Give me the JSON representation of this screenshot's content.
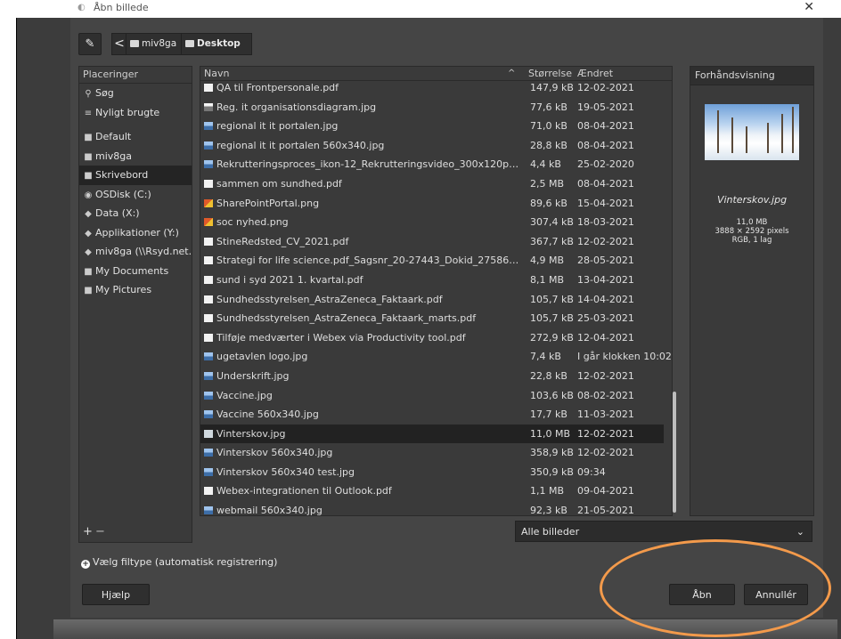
{
  "dialog": {
    "title": "Åbn billede",
    "close_label": "✕"
  },
  "toolbar": {
    "edit_location_icon": "edit-icon",
    "back_label": "<"
  },
  "breadcrumbs": [
    "miv8ga",
    "Desktop"
  ],
  "places": {
    "header": "Placeringer",
    "items": [
      {
        "label": "Søg",
        "icon": "search-icon",
        "glyph": "⚲"
      },
      {
        "label": "Nyligt brugte",
        "icon": "recent-icon",
        "glyph": "≡"
      },
      {
        "label": "Default",
        "icon": "folder-icon",
        "glyph": "■"
      },
      {
        "label": "miv8ga",
        "icon": "folder-icon",
        "glyph": "■"
      },
      {
        "label": "Skrivebord",
        "icon": "folder-icon",
        "glyph": "■",
        "active": true
      },
      {
        "label": "OSDisk (C:)",
        "icon": "drive-icon",
        "glyph": "◉"
      },
      {
        "label": "Data (X:)",
        "icon": "network-drive-icon",
        "glyph": "◆"
      },
      {
        "label": "Applikationer (Y:)",
        "icon": "network-drive-icon",
        "glyph": "◆"
      },
      {
        "label": "miv8ga (\\\\Rsyd.net...",
        "icon": "network-drive-icon",
        "glyph": "◆"
      },
      {
        "label": "My Documents",
        "icon": "folder-icon",
        "glyph": "■"
      },
      {
        "label": "My Pictures",
        "icon": "folder-icon",
        "glyph": "■"
      }
    ],
    "add_label": "+",
    "remove_label": "−"
  },
  "files": {
    "columns": {
      "name": "Navn",
      "size": "Størrelse",
      "modified": "Ændret",
      "sort_indicator": "^"
    },
    "rows": [
      {
        "name": "QA til Frontpersonale.pdf",
        "size": "147,9 kB",
        "date": "12-02-2021",
        "type": "pdf"
      },
      {
        "name": "Reg. it organisationsdiagram.jpg",
        "size": "77,6 kB",
        "date": "19-05-2021",
        "type": "dia"
      },
      {
        "name": "regional it it portalen.jpg",
        "size": "71,0 kB",
        "date": "08-04-2021",
        "type": "img"
      },
      {
        "name": "regional it it portalen 560x340.jpg",
        "size": "28,8 kB",
        "date": "08-04-2021",
        "type": "img"
      },
      {
        "name": "Rekrutteringsproces_ikon-12_Rekrutteringsvideo_300x120px_web...",
        "size": "4,4 kB",
        "date": "25-02-2020",
        "type": "img"
      },
      {
        "name": "sammen om sundhed.pdf",
        "size": "2,5 MB",
        "date": "08-04-2021",
        "type": "pdf"
      },
      {
        "name": "SharePointPortal.png",
        "size": "89,6 kB",
        "date": "15-04-2021",
        "type": "png"
      },
      {
        "name": "soc nyhed.png",
        "size": "307,4 kB",
        "date": "18-03-2021",
        "type": "png"
      },
      {
        "name": "StineRedsted_CV_2021.pdf",
        "size": "367,7 kB",
        "date": "12-02-2021",
        "type": "pdf"
      },
      {
        "name": "Strategi for life science.pdf_Sagsnr_20-27443_Dokid_275863-21_...",
        "size": "4,9 MB",
        "date": "28-05-2021",
        "type": "pdf"
      },
      {
        "name": "sund i syd 2021 1. kvartal.pdf",
        "size": "8,1 MB",
        "date": "13-04-2021",
        "type": "pdf"
      },
      {
        "name": "Sundhedsstyrelsen_AstraZeneca_Faktaark.pdf",
        "size": "105,7 kB",
        "date": "14-04-2021",
        "type": "pdf"
      },
      {
        "name": "Sundhedsstyrelsen_AstraZeneca_Faktaark_marts.pdf",
        "size": "105,7 kB",
        "date": "25-03-2021",
        "type": "pdf"
      },
      {
        "name": "Tilføje medværter i Webex via Productivity tool.pdf",
        "size": "272,9 kB",
        "date": "12-04-2021",
        "type": "pdf"
      },
      {
        "name": "ugetavlen logo.jpg",
        "size": "7,4 kB",
        "date": "I går klokken 10:02",
        "type": "img"
      },
      {
        "name": "Underskrift.jpg",
        "size": "22,8 kB",
        "date": "12-02-2021",
        "type": "img"
      },
      {
        "name": "Vaccine.jpg",
        "size": "103,6 kB",
        "date": "08-02-2021",
        "type": "img"
      },
      {
        "name": "Vaccine 560x340.jpg",
        "size": "17,7 kB",
        "date": "11-03-2021",
        "type": "img"
      },
      {
        "name": "Vinterskov.jpg",
        "size": "11,0 MB",
        "date": "12-02-2021",
        "type": "photo",
        "selected": true
      },
      {
        "name": "Vinterskov 560x340.jpg",
        "size": "358,9 kB",
        "date": "12-02-2021",
        "type": "img"
      },
      {
        "name": "Vinterskov 560x340 test.jpg",
        "size": "350,9 kB",
        "date": "09:34",
        "type": "img"
      },
      {
        "name": "Webex-integrationen til Outlook.pdf",
        "size": "1,1 MB",
        "date": "09-04-2021",
        "type": "pdf"
      },
      {
        "name": "webmail 560x340.jpg",
        "size": "92,3 kB",
        "date": "21-05-2021",
        "type": "img"
      }
    ]
  },
  "preview": {
    "header": "Forhåndsvisning",
    "name": "Vinterskov.jpg",
    "size": "11,0 MB",
    "dims": "3888 × 2592 pixels",
    "mode": "RGB, 1 lag"
  },
  "filter": {
    "selected": "Alle billeder"
  },
  "filetype": {
    "label": "Vælg filtype (automatisk registrering)",
    "toggle_glyph": "+"
  },
  "buttons": {
    "help": "Hjælp",
    "open": "Åbn",
    "cancel": "Annullér"
  },
  "annotation_color": "#f39a4b"
}
